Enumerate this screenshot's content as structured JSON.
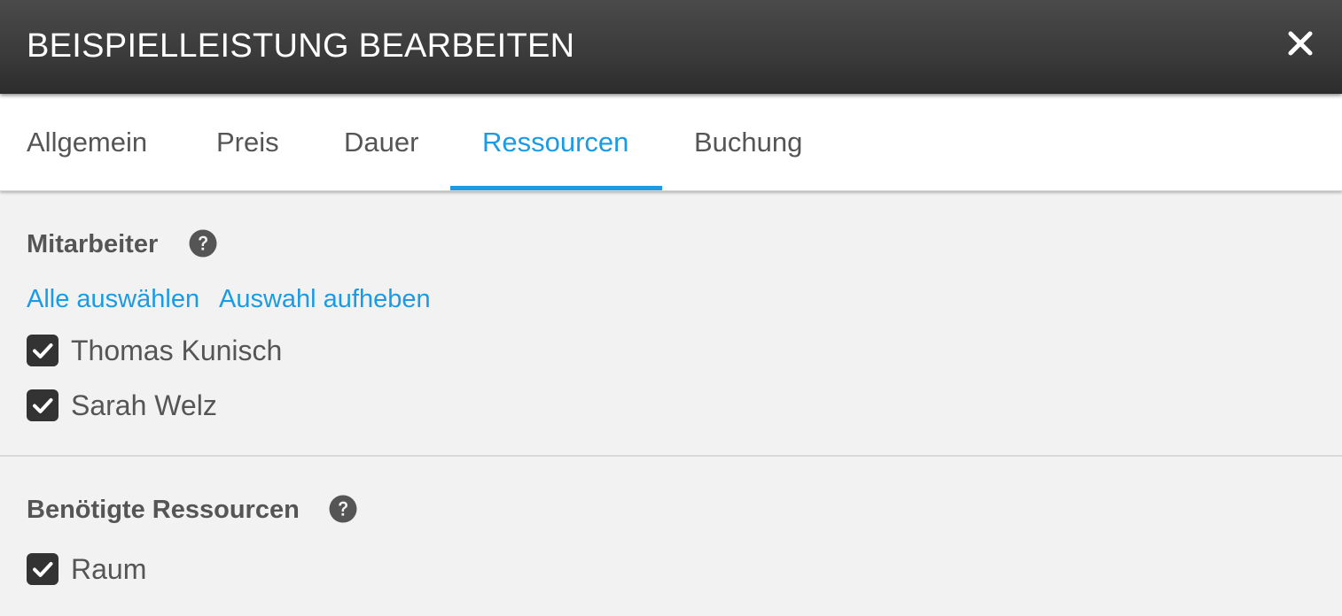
{
  "dialog": {
    "title": "BEISPIELLEISTUNG BEARBEITEN",
    "close_icon": "close-icon"
  },
  "tabs": [
    {
      "label": "Allgemein",
      "active": false
    },
    {
      "label": "Preis",
      "active": false
    },
    {
      "label": "Dauer",
      "active": false
    },
    {
      "label": "Ressourcen",
      "active": true
    },
    {
      "label": "Buchung",
      "active": false
    }
  ],
  "staff": {
    "title": "Mitarbeiter",
    "help_icon": "question-circle-icon",
    "select_all": "Alle auswählen",
    "deselect_all": "Auswahl aufheben",
    "members": [
      {
        "name": "Thomas Kunisch",
        "checked": true
      },
      {
        "name": "Sarah Welz",
        "checked": true
      }
    ]
  },
  "resources": {
    "title": "Benötigte Ressourcen",
    "help_icon": "question-circle-icon",
    "items": [
      {
        "name": "Raum",
        "checked": true
      }
    ]
  },
  "colors": {
    "accent": "#1a9be6",
    "header": "#3a3a3a",
    "text": "#555555",
    "checkbox": "#333333",
    "background": "#f2f2f2"
  }
}
